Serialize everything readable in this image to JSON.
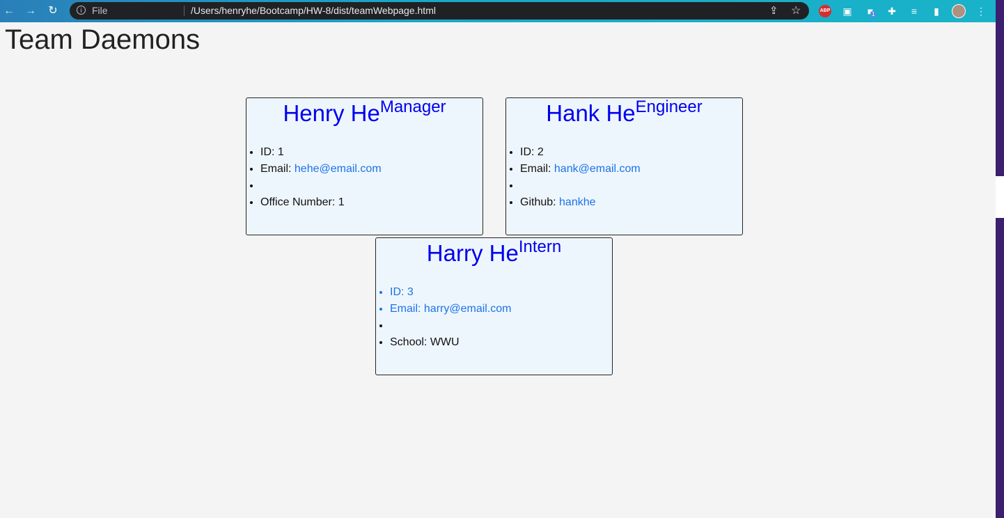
{
  "browser": {
    "scheme_label": "File",
    "url": "/Users/henryhe/Bootcamp/HW-8/dist/teamWebpage.html",
    "extensions": [
      {
        "icon": "adblock-plus-icon",
        "label": "ABP"
      },
      {
        "icon": "extension-badge-icon",
        "badge": "1"
      }
    ]
  },
  "page": {
    "title": "Team Daemons"
  },
  "cards": [
    {
      "name": "Henry He",
      "role": "Manager",
      "id_text": "ID: 1",
      "email_label": "Email: ",
      "email": "hehe@email.com",
      "extra_label": "Office Number: 1",
      "extra_link": ""
    },
    {
      "name": "Hank He",
      "role": "Engineer",
      "id_text": "ID: 2",
      "email_label": "Email: ",
      "email": "hank@email.com",
      "extra_label": "Github: ",
      "extra_link": "hankhe"
    },
    {
      "name": "Harry He",
      "role": "Intern",
      "id_text": "ID: 3",
      "email_label": "Email: ",
      "email": "harry@email.com",
      "extra_label": "School: WWU",
      "extra_link": ""
    }
  ],
  "colors": {
    "name": "#0000ee",
    "link": "#1a73e8",
    "card_bg": "#eef6fd",
    "page_bg": "#f4f4f4"
  }
}
